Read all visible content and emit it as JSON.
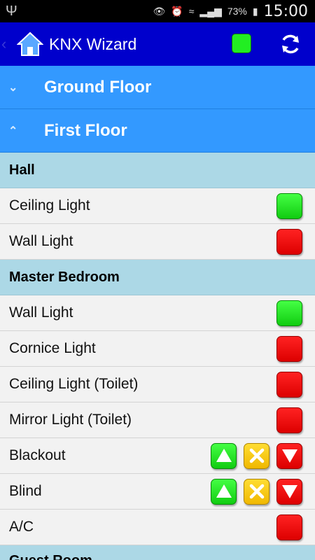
{
  "status_bar": {
    "battery": "73%",
    "time": "15:00"
  },
  "app_bar": {
    "title": "KNX Wizard",
    "status_color": "#22ee22"
  },
  "floors": [
    {
      "name": "Ground Floor",
      "expanded": false
    },
    {
      "name": "First Floor",
      "expanded": true
    }
  ],
  "rooms": [
    {
      "name": "Hall",
      "devices": [
        {
          "name": "Ceiling Light",
          "state": "on"
        },
        {
          "name": "Wall Light",
          "state": "off"
        }
      ]
    },
    {
      "name": "Master Bedroom",
      "devices": [
        {
          "name": "Wall Light",
          "state": "on"
        },
        {
          "name": "Cornice Light",
          "state": "off"
        },
        {
          "name": "Ceiling Light (Toilet)",
          "state": "off"
        },
        {
          "name": "Mirror Light (Toilet)",
          "state": "off"
        },
        {
          "name": "Blackout",
          "type": "blind"
        },
        {
          "name": "Blind",
          "type": "blind"
        },
        {
          "name": "A/C",
          "state": "off"
        }
      ]
    },
    {
      "name": "Guest Room",
      "devices": []
    }
  ],
  "colors": {
    "on": "#22ee22",
    "off": "#ee0000",
    "stop": "#f5c518",
    "action_bar": "#0000cc",
    "floor": "#3399ff",
    "room": "#acd8e6"
  }
}
